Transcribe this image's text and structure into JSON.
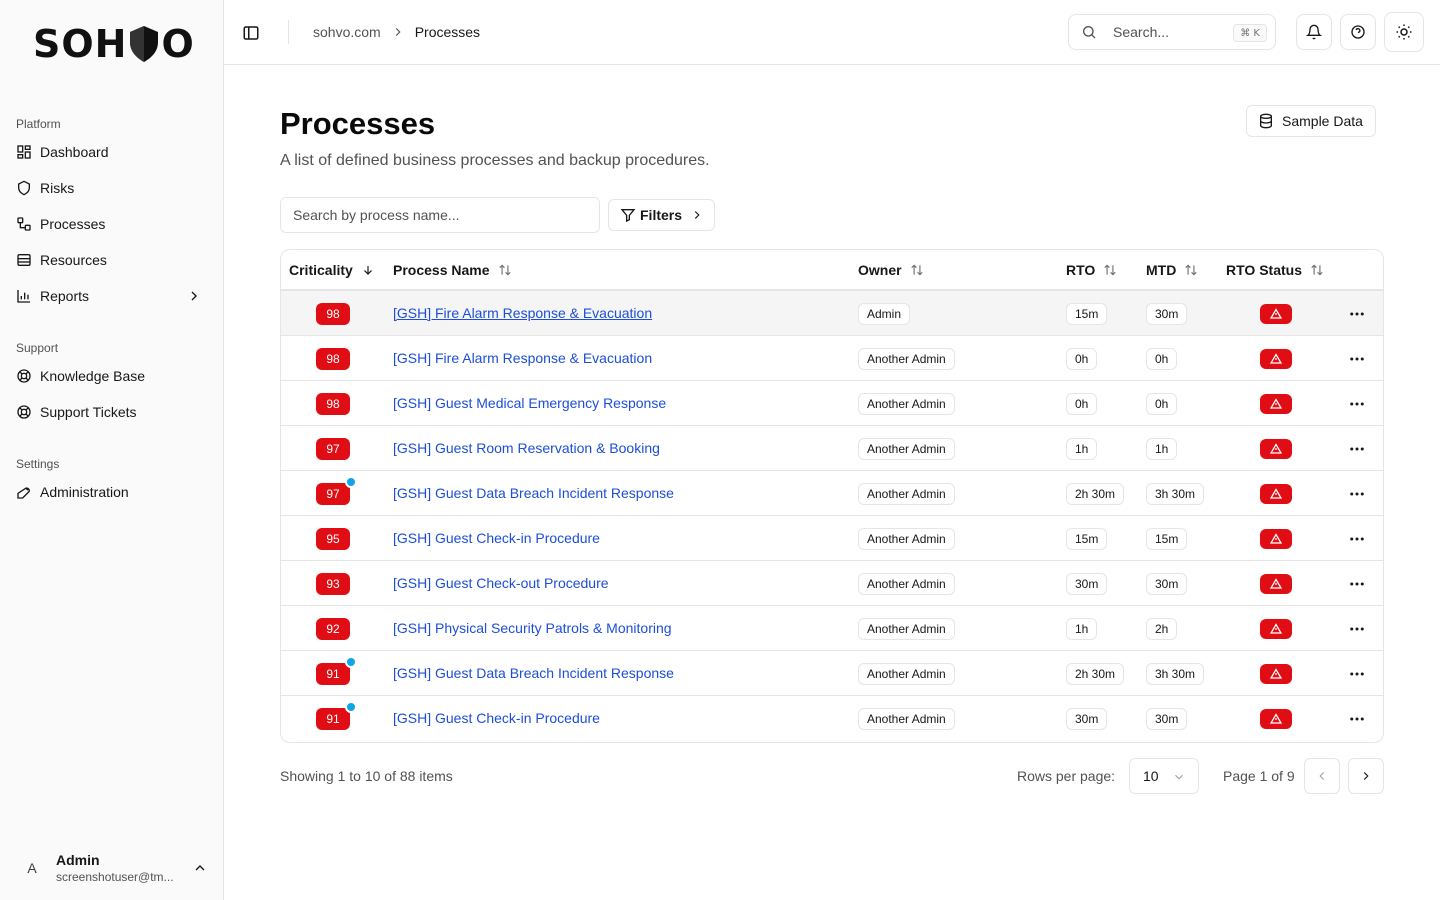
{
  "brand": {
    "logo_left": "SOH",
    "logo_right": "O"
  },
  "sidebar": {
    "sections": [
      {
        "label": "Platform",
        "items": [
          {
            "label": "Dashboard",
            "icon": "dashboard-icon"
          },
          {
            "label": "Risks",
            "icon": "shield-icon"
          },
          {
            "label": "Processes",
            "icon": "workflow-icon"
          },
          {
            "label": "Resources",
            "icon": "database-icon"
          },
          {
            "label": "Reports",
            "icon": "chart-icon"
          }
        ]
      },
      {
        "label": "Support",
        "items": [
          {
            "label": "Knowledge Base",
            "icon": "lifebuoy-icon"
          },
          {
            "label": "Support Tickets",
            "icon": "lifebuoy-icon"
          }
        ]
      },
      {
        "label": "Settings",
        "items": [
          {
            "label": "Administration",
            "icon": "wrench-icon"
          }
        ]
      }
    ],
    "user": {
      "initial": "A",
      "name": "Admin",
      "email": "screenshotuser@tm..."
    }
  },
  "header": {
    "breadcrumb": {
      "root": "sohvo.com",
      "current": "Processes"
    },
    "search": {
      "placeholder": "Search...",
      "shortcut": "⌘ K"
    }
  },
  "main": {
    "title": "Processes",
    "subtitle": "A list of defined business processes and backup procedures.",
    "sample_button": "Sample Data",
    "search_placeholder": "Search by process name...",
    "filters_button": "Filters",
    "columns": [
      "Criticality",
      "Process Name",
      "Owner",
      "RTO",
      "MTD",
      "RTO Status"
    ],
    "rows": [
      {
        "criticality": "98",
        "name": "[GSH] Fire Alarm Response & Evacuation",
        "owner": "Admin",
        "rto": "15m",
        "mtd": "30m",
        "dot": false
      },
      {
        "criticality": "98",
        "name": "[GSH] Fire Alarm Response & Evacuation",
        "owner": "Another Admin",
        "rto": "0h",
        "mtd": "0h",
        "dot": false
      },
      {
        "criticality": "98",
        "name": "[GSH] Guest Medical Emergency Response",
        "owner": "Another Admin",
        "rto": "0h",
        "mtd": "0h",
        "dot": false
      },
      {
        "criticality": "97",
        "name": "[GSH] Guest Room Reservation & Booking",
        "owner": "Another Admin",
        "rto": "1h",
        "mtd": "1h",
        "dot": false
      },
      {
        "criticality": "97",
        "name": "[GSH] Guest Data Breach Incident Response",
        "owner": "Another Admin",
        "rto": "2h 30m",
        "mtd": "3h 30m",
        "dot": true
      },
      {
        "criticality": "95",
        "name": "[GSH] Guest Check-in Procedure",
        "owner": "Another Admin",
        "rto": "15m",
        "mtd": "15m",
        "dot": false
      },
      {
        "criticality": "93",
        "name": "[GSH] Guest Check-out Procedure",
        "owner": "Another Admin",
        "rto": "30m",
        "mtd": "30m",
        "dot": false
      },
      {
        "criticality": "92",
        "name": "[GSH] Physical Security Patrols & Monitoring",
        "owner": "Another Admin",
        "rto": "1h",
        "mtd": "2h",
        "dot": false
      },
      {
        "criticality": "91",
        "name": "[GSH] Guest Data Breach Incident Response",
        "owner": "Another Admin",
        "rto": "2h 30m",
        "mtd": "3h 30m",
        "dot": true
      },
      {
        "criticality": "91",
        "name": "[GSH] Guest Check-in Procedure",
        "owner": "Another Admin",
        "rto": "30m",
        "mtd": "30m",
        "dot": true
      }
    ],
    "footer": {
      "showing": "Showing 1 to 10 of 88 items",
      "rows_per_page_label": "Rows per page:",
      "rows_per_page": "10",
      "page_info": "Page 1 of 9"
    }
  },
  "colors": {
    "accent": "#e10d14",
    "link": "#1d4ed8",
    "badge_dot": "#0ea5e9"
  }
}
